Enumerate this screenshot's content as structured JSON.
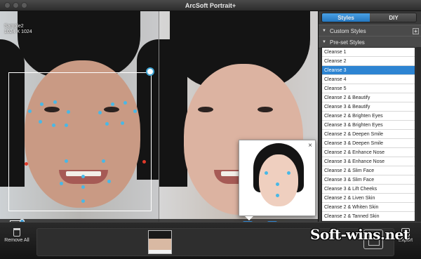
{
  "window": {
    "title": "ArcSoft Portrait+"
  },
  "photo": {
    "sample_label": "Sample2",
    "sample_size": "1024 X 1024"
  },
  "sidebar": {
    "tabs": [
      {
        "label": "Styles",
        "active": true
      },
      {
        "label": "DIY",
        "active": false
      }
    ],
    "custom_section": "Custom Styles",
    "custom_add": "+",
    "preset_section": "Pre-set Styles",
    "selected_index": 2,
    "items": [
      "Cleanse 1",
      "Cleanse 2",
      "Cleanse 3",
      "Cleanse 4",
      "Cleanse 5",
      "Cleanse 2 & Beautify",
      "Cleanse 3 & Beautify",
      "Cleanse 2 & Brighten Eyes",
      "Cleanse 3 & Brighten Eyes",
      "Cleanse 2 & Deepen Smile",
      "Cleanse 3 & Deepen Smile",
      "Cleanse 2 & Enhance Nose",
      "Cleanse 3 & Enhance Nose",
      "Cleanse 2 & Slim Face",
      "Cleanse 3 & Slim Face",
      "Cleanse 3 & Lift Cheeks",
      "Cleanse 2 & Liven Skin",
      "Cleanse 2 & Whiten Skin",
      "Cleanse 2 & Tanned Skin"
    ]
  },
  "popup": {
    "close": "×"
  },
  "toolbar": {
    "help": "?",
    "zoom_out": "⊖",
    "zoom_in": "⊕",
    "fit": "⤡",
    "compare": "⇆",
    "face": "☺",
    "eraser": "✎",
    "brush": "✐"
  },
  "bottom": {
    "remove_all": "Remove All",
    "export": "Export"
  },
  "watermark": "Soft-wins.net",
  "colors": {
    "accent": "#2d84d2",
    "landmark": "#48b8e6",
    "landmark_alt": "#e03a2a"
  }
}
